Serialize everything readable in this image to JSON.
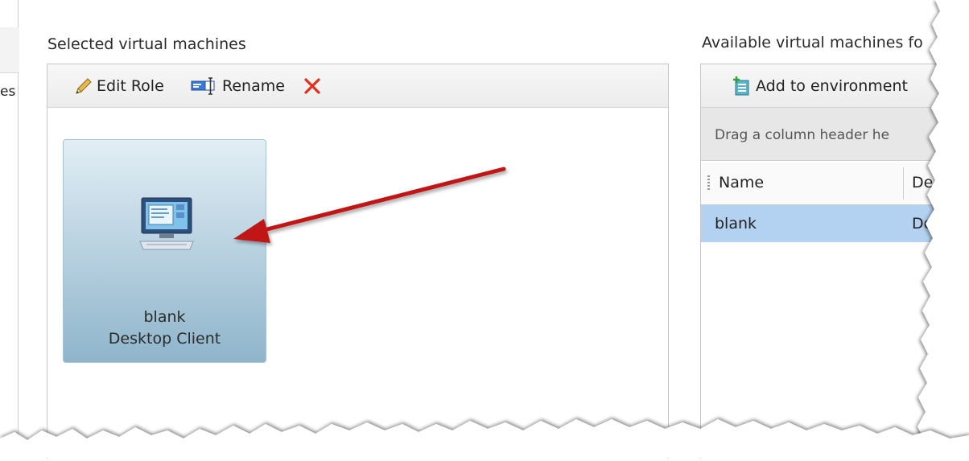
{
  "left_strip": {
    "text": "es"
  },
  "selected_panel": {
    "title": "Selected virtual machines",
    "toolbar": {
      "edit_role_label": "Edit Role",
      "rename_label": "Rename"
    },
    "vm_tile": {
      "name": "blank",
      "role": "Desktop Client"
    }
  },
  "available_panel": {
    "title": "Available virtual machines fo",
    "toolbar": {
      "add_label": "Add to environment"
    },
    "group_hint": "Drag a column header he",
    "columns": [
      "Name",
      "De"
    ],
    "rows": [
      {
        "name": "blank",
        "description": "De"
      }
    ]
  },
  "icons": [
    "pencil-icon",
    "rename-icon",
    "delete-icon",
    "desktop-client-icon",
    "add-vm-icon"
  ],
  "colors": {
    "tile_gradient_top": "#e2eef5",
    "tile_gradient_bottom": "#8fb5cb",
    "selected_row": "#b3d1f0",
    "delete_red": "#e0301e",
    "arrow_red": "#c01818"
  }
}
